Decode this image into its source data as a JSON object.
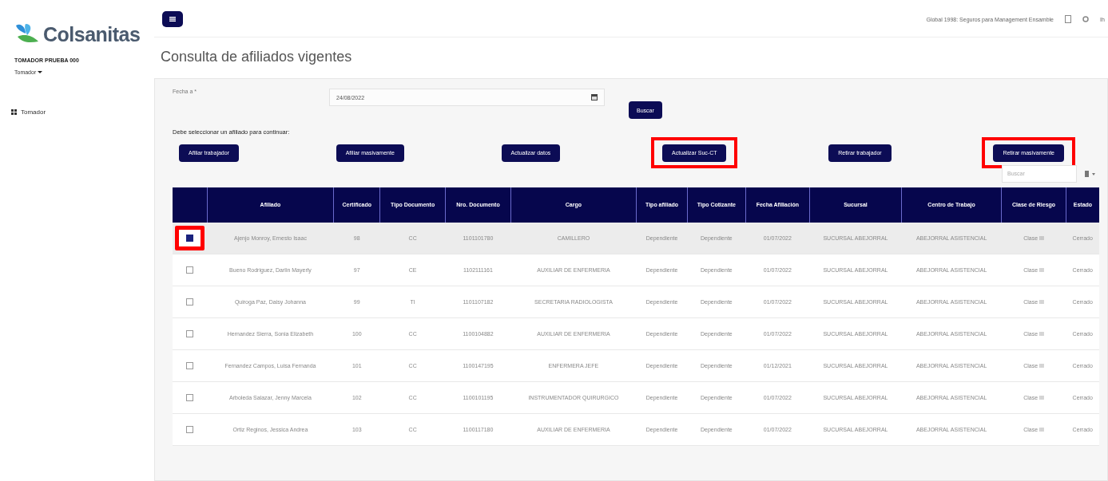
{
  "sidebar": {
    "logo_text": "Colsanitas",
    "user": "TOMADOR PRUEBA 000",
    "role_menu": "Tomador",
    "items": [
      {
        "label": "Tomador",
        "selected": false
      }
    ]
  },
  "topbar": {
    "info": "Global 1998: Seguros para Management Ensamble",
    "corner_text": "Ih"
  },
  "page_title": "Consulta de afiliados vigentes",
  "form": {
    "date_label": "Fecha a *",
    "date_value": "24/08/2022",
    "search_button": "Buscar"
  },
  "instruction": "Debe seleccionar un afiliado para continuar:",
  "actions": [
    {
      "label": "Afiliar trabajador",
      "highlighted": false
    },
    {
      "label": "Afiliar masivamente",
      "highlighted": false
    },
    {
      "label": "Actualizar datos",
      "highlighted": false
    },
    {
      "label": "Actualizar Suc-CT",
      "highlighted": true
    },
    {
      "label": "Retirar trabajador",
      "highlighted": false
    },
    {
      "label": "Retirar masivamente",
      "highlighted": true
    }
  ],
  "table_search": {
    "placeholder": "Buscar"
  },
  "table": {
    "columns": [
      "Afiliado",
      "Certificado",
      "Tipo Documento",
      "Nro. Documento",
      "Cargo",
      "Tipo afiliado",
      "Tipo Cotizante",
      "Fecha Afiliación",
      "Sucursal",
      "Centro de Trabajo",
      "Clase de Riesgo",
      "Estado"
    ],
    "rows": [
      {
        "selected": true,
        "highlighted": true,
        "cells": [
          "Ajenjo Monroy, Ernesto Isaac",
          "98",
          "CC",
          "1101101780",
          "CAMILLERO",
          "Dependiente",
          "Dependiente",
          "01/07/2022",
          "SUCURSAL ABEJORRAL",
          "ABEJORRAL ASISTENCIAL",
          "Clase III",
          "Cerrado"
        ]
      },
      {
        "selected": false,
        "highlighted": false,
        "cells": [
          "Bueno Rodriguez, Darlin Mayerly",
          "97",
          "CE",
          "1102111161",
          "AUXILIAR DE ENFERMERIA",
          "Dependiente",
          "Dependiente",
          "01/07/2022",
          "SUCURSAL ABEJORRAL",
          "ABEJORRAL ASISTENCIAL",
          "Clase III",
          "Cerrado"
        ]
      },
      {
        "selected": false,
        "highlighted": false,
        "cells": [
          "Quiroga Paz, Daisy Johanna",
          "99",
          "TI",
          "1101107182",
          "SECRETARIA RADIOLOGISTA",
          "Dependiente",
          "Dependiente",
          "01/07/2022",
          "SUCURSAL ABEJORRAL",
          "ABEJORRAL ASISTENCIAL",
          "Clase III",
          "Cerrado"
        ]
      },
      {
        "selected": false,
        "highlighted": false,
        "cells": [
          "Hernandez Sierra, Sonia Elizabeth",
          "100",
          "CC",
          "1100104882",
          "AUXILIAR DE ENFERMERIA",
          "Dependiente",
          "Dependiente",
          "01/07/2022",
          "SUCURSAL ABEJORRAL",
          "ABEJORRAL ASISTENCIAL",
          "Clase III",
          "Cerrado"
        ]
      },
      {
        "selected": false,
        "highlighted": false,
        "cells": [
          "Fernandez Campos, Luisa Fernanda",
          "101",
          "CC",
          "1100147195",
          "ENFERMERA JEFE",
          "Dependiente",
          "Dependiente",
          "01/12/2021",
          "SUCURSAL ABEJORRAL",
          "ABEJORRAL ASISTENCIAL",
          "Clase III",
          "Cerrado"
        ]
      },
      {
        "selected": false,
        "highlighted": false,
        "cells": [
          "Arboleda Salazar, Jenny Marcela",
          "102",
          "CC",
          "1100101195",
          "INSTRUMENTADOR QUIRURGICO",
          "Dependiente",
          "Dependiente",
          "01/07/2022",
          "SUCURSAL ABEJORRAL",
          "ABEJORRAL ASISTENCIAL",
          "Clase III",
          "Cerrado"
        ]
      },
      {
        "selected": false,
        "highlighted": false,
        "cells": [
          "Ortiz Reginos, Jessica Andrea",
          "103",
          "CC",
          "1100117180",
          "AUXILIAR DE ENFERMERIA",
          "Dependiente",
          "Dependiente",
          "01/07/2022",
          "SUCURSAL ABEJORRAL",
          "ABEJORRAL ASISTENCIAL",
          "Clase III",
          "Cerrado"
        ]
      }
    ]
  }
}
